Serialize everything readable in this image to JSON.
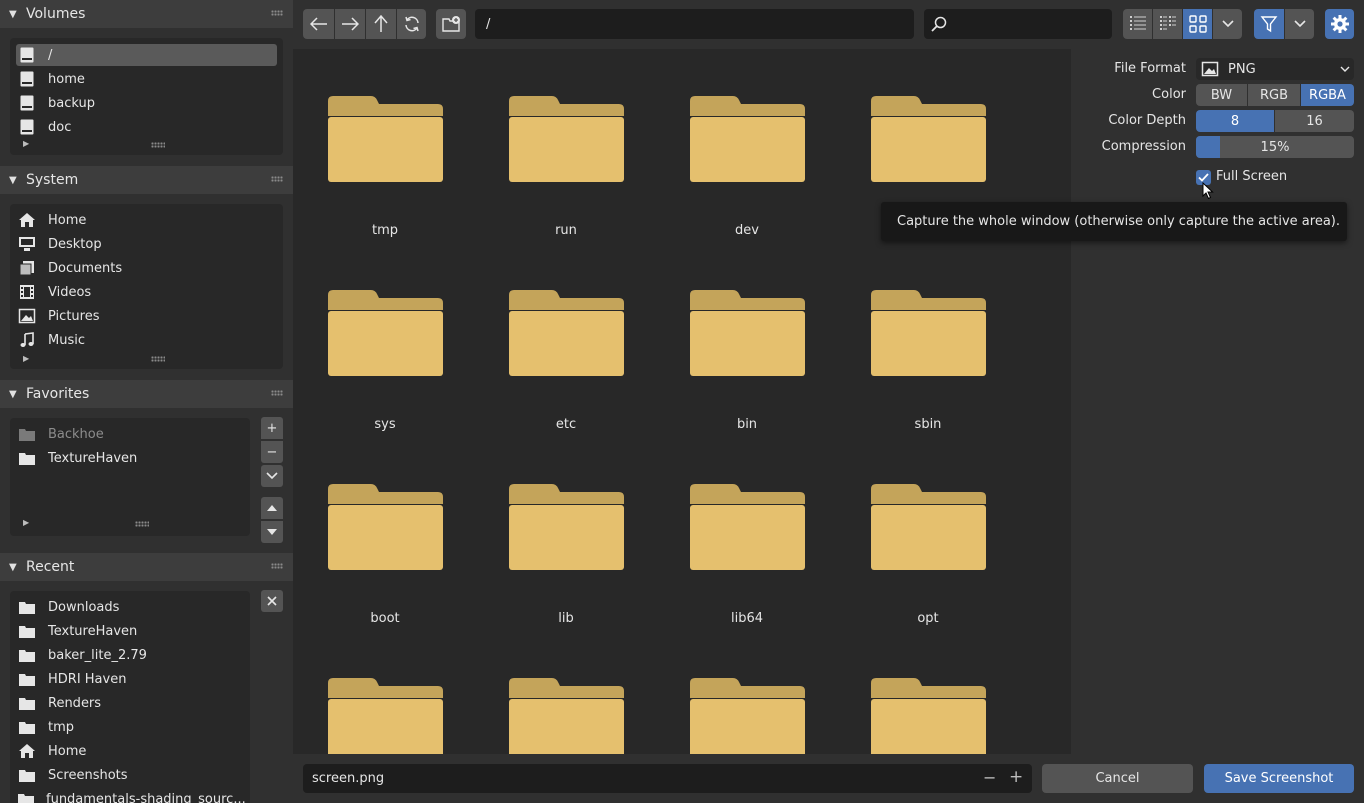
{
  "sidebar": {
    "volumes": {
      "title": "Volumes",
      "items": [
        {
          "label": "/",
          "icon": "drive-icon",
          "selected": true
        },
        {
          "label": "home",
          "icon": "drive-icon"
        },
        {
          "label": "backup",
          "icon": "drive-icon"
        },
        {
          "label": "doc",
          "icon": "drive-icon"
        }
      ]
    },
    "system": {
      "title": "System",
      "items": [
        {
          "label": "Home",
          "icon": "home-icon"
        },
        {
          "label": "Desktop",
          "icon": "desktop-icon"
        },
        {
          "label": "Documents",
          "icon": "documents-icon"
        },
        {
          "label": "Videos",
          "icon": "film-icon"
        },
        {
          "label": "Pictures",
          "icon": "image-icon"
        },
        {
          "label": "Music",
          "icon": "music-icon"
        }
      ]
    },
    "favorites": {
      "title": "Favorites",
      "items": [
        {
          "label": "Backhoe",
          "icon": "folder-icon",
          "dimmed": true
        },
        {
          "label": "TextureHaven",
          "icon": "folder-icon"
        }
      ],
      "buttons": [
        "+",
        "−"
      ]
    },
    "recent": {
      "title": "Recent",
      "items": [
        {
          "label": "Downloads",
          "icon": "folder-icon"
        },
        {
          "label": "TextureHaven",
          "icon": "folder-icon"
        },
        {
          "label": "baker_lite_2.79",
          "icon": "folder-icon"
        },
        {
          "label": "HDRI Haven",
          "icon": "folder-icon"
        },
        {
          "label": "Renders",
          "icon": "folder-icon"
        },
        {
          "label": "tmp",
          "icon": "folder-icon"
        },
        {
          "label": "Home",
          "icon": "home-icon"
        },
        {
          "label": "Screenshots",
          "icon": "folder-icon"
        },
        {
          "label": "fundamentals-shading_sourc...",
          "icon": "folder-icon"
        }
      ]
    }
  },
  "toolbar": {
    "path": "/",
    "search_placeholder": ""
  },
  "files": {
    "folders": [
      "tmp",
      "run",
      "dev",
      "",
      "sys",
      "etc",
      "bin",
      "sbin",
      "boot",
      "lib",
      "lib64",
      "opt",
      "",
      "",
      "",
      ""
    ]
  },
  "properties": {
    "file_format": {
      "label": "File Format",
      "value": "PNG"
    },
    "color": {
      "label": "Color",
      "options": [
        "BW",
        "RGB",
        "RGBA"
      ],
      "selected": "RGBA"
    },
    "color_depth": {
      "label": "Color Depth",
      "options": [
        "8",
        "16"
      ],
      "selected": "8"
    },
    "compression": {
      "label": "Compression",
      "value": 15,
      "display": "15%"
    },
    "full_screen": {
      "label": "Full Screen",
      "checked": true
    }
  },
  "tooltip": "Capture the whole window (otherwise only capture the active area).",
  "footer": {
    "filename": "screen.png",
    "decrement": "−",
    "increment": "+",
    "cancel": "Cancel",
    "save": "Save Screenshot"
  },
  "colors": {
    "accent": "#4772b3",
    "folder": "#e5c06e",
    "folder_tab": "#c4a45a"
  }
}
